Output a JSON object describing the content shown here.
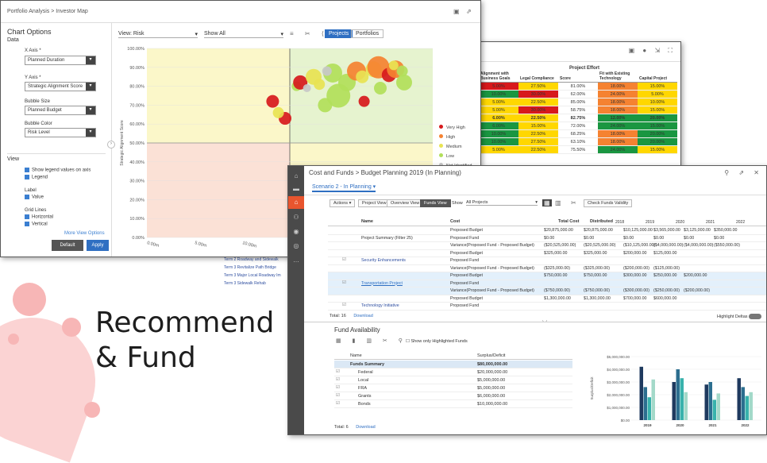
{
  "slide": {
    "big_text_1": "Recommend",
    "big_text_2": "& Fund",
    "edge_text": "e"
  },
  "portfolio": {
    "breadcrumb": "Portfolio Analysis  >  Investor Map",
    "panel_title": "Chart Options",
    "data_label": "Data",
    "x_axis_label": "X Axis *",
    "x_axis_value": "Planned Duration",
    "y_axis_label": "Y Axis *",
    "y_axis_value": "Strategic Alignment Score",
    "bubble_size_label": "Bubble Size",
    "bubble_size_value": "Planned Budget",
    "bubble_color_label": "Bubble Color",
    "bubble_color_value": "Risk Level",
    "view_label": "View",
    "view_opt1": "Show legend values on axis",
    "view_opt2": "Legend",
    "label_heading": "Label",
    "label_opt1": "Value",
    "grid_heading": "Grid Lines",
    "grid_opt1": "Horizontal",
    "grid_opt2": "Vertical",
    "more_link": "More View Options",
    "default_btn": "Default",
    "apply_btn": "Apply",
    "view_field": "View:  Risk",
    "show_field": "Show  All",
    "projects_tab": "Projects",
    "portfolios_tab": "Portfolios",
    "y_axis_title": "Strategic Alignment Score",
    "x_axis_title": "Planned",
    "legend": [
      "Very High",
      "High",
      "Medium",
      "Low",
      "Not Identified"
    ],
    "colors": {
      "very_high": "#d7191c",
      "high": "#f58231",
      "medium": "#e8e352",
      "low": "#b2df5a",
      "not_identified": "#c8c8c8"
    },
    "chart_data": {
      "type": "scatter",
      "yticks": [
        "100.00%",
        "90.00%",
        "80.00%",
        "70.00%",
        "60.00%",
        "50.00%",
        "40.00%",
        "30.00%",
        "20.00%",
        "10.00%",
        "0.00%"
      ],
      "xticks": [
        "0.00m",
        "5.00m",
        "10.00m",
        "15.00m",
        "20.00m",
        "25.00m"
      ],
      "ylim": [
        0,
        100
      ],
      "xlim": [
        0,
        30
      ],
      "points": [
        {
          "x": 13.2,
          "y": 72,
          "r": 8,
          "c": "very_high"
        },
        {
          "x": 14.5,
          "y": 63,
          "r": 8,
          "c": "very_high"
        },
        {
          "x": 13.8,
          "y": 66,
          "r": 7,
          "c": "medium"
        },
        {
          "x": 15.7,
          "y": 80,
          "r": 6,
          "c": "low"
        },
        {
          "x": 16.1,
          "y": 82,
          "r": 9,
          "c": "very_high"
        },
        {
          "x": 17.5,
          "y": 85,
          "r": 10,
          "c": "medium"
        },
        {
          "x": 18.1,
          "y": 81,
          "r": 7,
          "c": "medium"
        },
        {
          "x": 19.5,
          "y": 87,
          "r": 12,
          "c": "low"
        },
        {
          "x": 20.1,
          "y": 75,
          "r": 15,
          "c": "low"
        },
        {
          "x": 21.0,
          "y": 82,
          "r": 11,
          "c": "low"
        },
        {
          "x": 22.0,
          "y": 88,
          "r": 12,
          "c": "high"
        },
        {
          "x": 22.6,
          "y": 85,
          "r": 8,
          "c": "medium"
        },
        {
          "x": 23.8,
          "y": 89,
          "r": 10,
          "c": "medium"
        },
        {
          "x": 24.3,
          "y": 90,
          "r": 14,
          "c": "high"
        },
        {
          "x": 25.4,
          "y": 86,
          "r": 9,
          "c": "very_high"
        },
        {
          "x": 26.1,
          "y": 89,
          "r": 11,
          "c": "high"
        },
        {
          "x": 25.9,
          "y": 91,
          "r": 6,
          "c": "medium"
        },
        {
          "x": 27.0,
          "y": 82,
          "r": 10,
          "c": "low"
        },
        {
          "x": 26.8,
          "y": 88,
          "r": 7,
          "c": "low"
        },
        {
          "x": 18.9,
          "y": 88,
          "r": 6,
          "c": "not_identified"
        },
        {
          "x": 16.8,
          "y": 79,
          "r": 5,
          "c": "not_identified"
        },
        {
          "x": 18.7,
          "y": 70,
          "r": 9,
          "c": "low"
        },
        {
          "x": 24.5,
          "y": 79,
          "r": 8,
          "c": "low"
        },
        {
          "x": 22.8,
          "y": 72,
          "r": 7,
          "c": "very_high"
        }
      ]
    }
  },
  "effort": {
    "group_header": "Project Effort",
    "col_headers": [
      "Alignment with Business Goals",
      "Legal Compliance",
      "Score",
      "Fit with Existing Technology",
      "Capital Project"
    ],
    "rows": [
      [
        "5.00%",
        "27.50%",
        "81.00%",
        "18.00%",
        "15.00%"
      ],
      [
        "10.00%",
        "30.00%",
        "62.00%",
        "24.00%",
        "5.00%"
      ],
      [
        "5.00%",
        "22.50%",
        "85.00%",
        "18.00%",
        "10.00%"
      ],
      [
        "5.00%",
        "30.00%",
        "58.75%",
        "18.00%",
        "15.00%"
      ],
      [
        "6.00%",
        "22.50%",
        "82.75%",
        "12.00%",
        "20.00%"
      ],
      [
        "6.00%",
        "15.00%",
        "72.00%",
        "24.00%",
        "15.00%"
      ],
      [
        "10.00%",
        "22.50%",
        "68.25%",
        "18.00%",
        "20.00%"
      ],
      [
        "10.00%",
        "27.50%",
        "63.10%",
        "18.00%",
        "20.00%"
      ],
      [
        "5.00%",
        "22.50%",
        "75.50%",
        "24.00%",
        "15.00%"
      ]
    ],
    "row_colors": [
      [
        "#d7191c",
        "#ffd700",
        "#fff",
        "#f58231",
        "#ffd700"
      ],
      [
        "#1a9641",
        "#d7191c",
        "#fff",
        "#f58231",
        "#ffd700"
      ],
      [
        "#ffd700",
        "#ffd700",
        "#fff",
        "#f58231",
        "#ffd700"
      ],
      [
        "#ffd700",
        "#d7191c",
        "#fff",
        "#f58231",
        "#ffd700"
      ],
      [
        "#ffd700",
        "#ffd700",
        "#fff",
        "#1a9641",
        "#1a9641"
      ],
      [
        "#1a9641",
        "#ffd700",
        "#fff",
        "#1a9641",
        "#1a9641"
      ],
      [
        "#1a9641",
        "#ffd700",
        "#fff",
        "#f58231",
        "#1a9641"
      ],
      [
        "#1a9641",
        "#ffd700",
        "#fff",
        "#f58231",
        "#1a9641"
      ],
      [
        "#ffd700",
        "#ffd700",
        "#fff",
        "#1a9641",
        "#ffd700"
      ]
    ],
    "side_items": [
      "Term 2 Roadway and Sidewalk",
      "Term 3 Revitalize Path Bridge",
      "Term 3 Major Local Roadway Im",
      "Term 3 Sidewalk Rehab"
    ]
  },
  "budget": {
    "breadcrumb": "Cost and Funds  >  Budget Planning  2019 (In Planning)",
    "scenario": "Scenario 2 - In Planning",
    "actions_btn": "Actions",
    "tabs": [
      "Project View",
      "Overview View",
      "Funds View"
    ],
    "show_label": "Show",
    "show_value": "All Projects",
    "check_btn": "Check Funds Validity",
    "col_name": "Name",
    "col_cost": "Cost",
    "col_total": "Total Cost",
    "col_dist": "Distributed",
    "years": [
      "2018",
      "2019",
      "2020",
      "2021",
      "2022"
    ],
    "rows": [
      {
        "name": "",
        "cost": "Proposed Budget",
        "total": "$20,875,000.00",
        "dist": "$20,875,000.00",
        "y": [
          "$10,125,000.00",
          "$3,565,000.00",
          "$3,125,000.00",
          "$350,000.00"
        ]
      },
      {
        "name": "Project Summary (Filter 25)",
        "cost": "Proposed Fund",
        "total": "$0.00",
        "dist": "$0.00",
        "y": [
          "$0.00",
          "$0.00",
          "$0.00",
          "$0.00"
        ]
      },
      {
        "name": "",
        "cost": "Variance(Proposed Fund - Proposed Budget)",
        "total": "($20,525,000.00)",
        "dist": "($20,525,000.00)",
        "y": [
          "($10,125,000.00)",
          "($4,000,000.00)",
          "($4,000,000.00)",
          "($550,000.00)"
        ]
      },
      {
        "name": "",
        "cost": "Proposed Budget",
        "total": "$325,000.00",
        "dist": "$325,000.00",
        "y": [
          "$200,000.00",
          "$125,000.00",
          "",
          ""
        ]
      },
      {
        "name": "Security Enhancements",
        "cost": "Proposed Fund",
        "total": "",
        "dist": "",
        "y": [
          "",
          "",
          "",
          ""
        ]
      },
      {
        "name": "",
        "cost": "Variance(Proposed Fund - Proposed Budget)",
        "total": "($325,000.00)",
        "dist": "($325,000.00)",
        "y": [
          "($200,000.00)",
          "($125,000.00)",
          "",
          ""
        ]
      },
      {
        "name": "",
        "cost": "Proposed Budget",
        "total": "$750,000.00",
        "dist": "$750,000.00",
        "y": [
          "$300,000.00",
          "$250,000.00",
          "$200,000.00",
          ""
        ]
      },
      {
        "name": "Transportation Project",
        "cost": "Proposed Fund",
        "total": "",
        "dist": "",
        "y": [
          "",
          "",
          "",
          ""
        ]
      },
      {
        "name": "",
        "cost": "Variance(Proposed Fund - Proposed Budget)",
        "total": "($750,000.00)",
        "dist": "($750,000.00)",
        "y": [
          "($300,000.00)",
          "($250,000.00)",
          "($200,000.00)",
          ""
        ]
      },
      {
        "name": "",
        "cost": "Proposed Budget",
        "total": "$1,300,000.00",
        "dist": "$1,300,000.00",
        "y": [
          "$700,000.00",
          "$600,000.00",
          "",
          ""
        ]
      },
      {
        "name": "Technology Initiative",
        "cost": "Proposed Fund",
        "total": "",
        "dist": "",
        "y": [
          "",
          "",
          "",
          ""
        ]
      }
    ],
    "total_text": "Total: 16",
    "download": "Download",
    "highlight": "Highlight Deltas",
    "fund_title": "Fund Availability",
    "show_any": "Show only Highlighted Funds",
    "fund_col1": "Name",
    "fund_col2": "Surplus/Deficit",
    "fund_rows": [
      {
        "name": "Funds Summary",
        "val": "$80,000,000.00"
      },
      {
        "name": "Federal",
        "val": "$20,000,000.00"
      },
      {
        "name": "Local",
        "val": "$5,000,000.00"
      },
      {
        "name": "FRA",
        "val": "$5,000,000.00"
      },
      {
        "name": "Grants",
        "val": "$6,000,000.00"
      },
      {
        "name": "Bonds",
        "val": "$10,000,000.00"
      }
    ],
    "fund_total": "Total: 6",
    "fund_download": "Download",
    "bar_chart": {
      "type": "bar",
      "ylabel": "Surplus/Deficit",
      "yticks": [
        "$5,000,000.00",
        "$4,000,000.00",
        "$3,000,000.00",
        "$2,000,000.00",
        "$1,000,000.00",
        "$0.00"
      ],
      "categories": [
        "2019",
        "2020",
        "2021",
        "2022"
      ],
      "ylim": [
        0,
        5000000
      ],
      "series_colors": [
        "#1f3a5f",
        "#2c6e8f",
        "#38b2ac",
        "#a3d9c9"
      ],
      "series": [
        {
          "values": [
            4200000,
            3000000,
            2800000,
            3300000
          ]
        },
        {
          "values": [
            2600000,
            4000000,
            3000000,
            2600000
          ]
        },
        {
          "values": [
            1800000,
            3300000,
            1600000,
            1900000
          ]
        },
        {
          "values": [
            3200000,
            2200000,
            2100000,
            2200000
          ]
        }
      ]
    }
  }
}
